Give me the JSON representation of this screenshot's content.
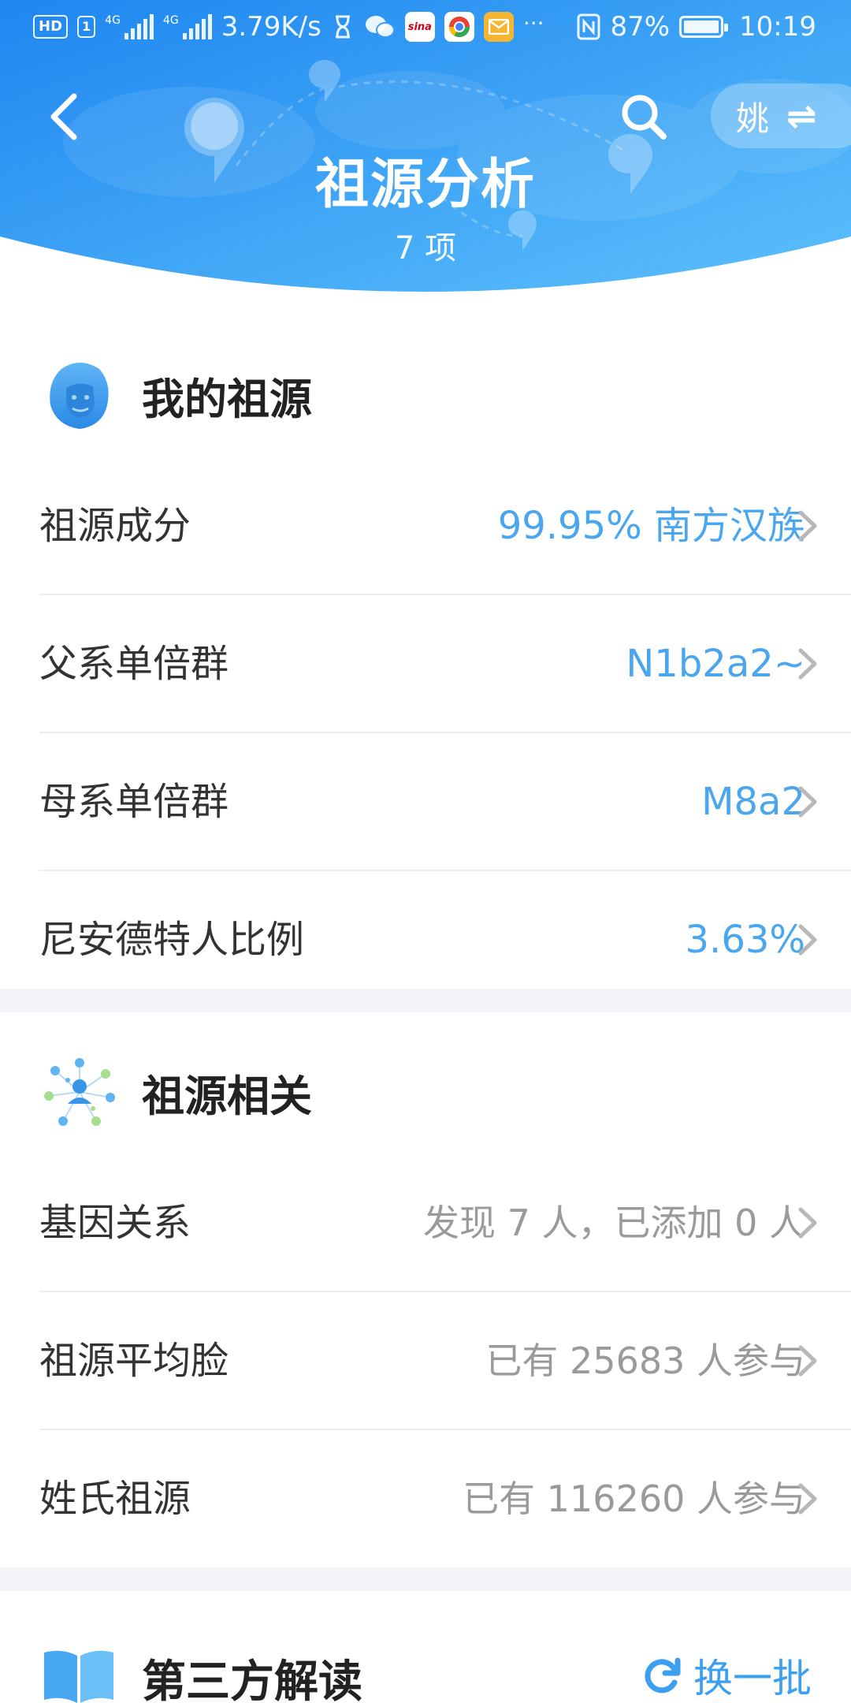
{
  "status_bar": {
    "chip_hd": "HD",
    "chip_sim": "1",
    "net_label_1": "4G",
    "net_label_2": "4G",
    "net_speed": "3.79K/s",
    "app_sina_label": "sina",
    "more": "···",
    "battery_text": "87%",
    "battery_level": 0.87,
    "time": "10:19"
  },
  "header": {
    "title": "祖源分析",
    "subtitle": "7 项",
    "surname": "姚",
    "switch_glyph": "⇌"
  },
  "my_ancestry": {
    "title": "我的祖源",
    "rows": [
      {
        "label": "祖源成分",
        "value": "99.95% 南方汉族"
      },
      {
        "label": "父系单倍群",
        "value": "N1b2a2~"
      },
      {
        "label": "母系单倍群",
        "value": "M8a2"
      },
      {
        "label": "尼安德特人比例",
        "value": "3.63%"
      }
    ]
  },
  "ancestry_related": {
    "title": "祖源相关",
    "rows": [
      {
        "label": "基因关系",
        "value": "发现 7 人，已添加 0 人"
      },
      {
        "label": "祖源平均脸",
        "value": "已有 25683 人参与"
      },
      {
        "label": "姓氏祖源",
        "value": "已有 116260 人参与"
      }
    ]
  },
  "third_party": {
    "title": "第三方解读",
    "refresh_label": "换一批"
  },
  "colors": {
    "header_gradient_start": "#1e86f0",
    "header_gradient_end": "#5cc0fb",
    "accent_value": "#4aa6ee",
    "secondary_value": "#9a9a9a",
    "separator_band": "#f3f5f8"
  },
  "icons": {
    "back": "chevron-left-icon",
    "search": "search-icon",
    "switch": "swap-arrows-icon",
    "my_ancestry": "ancestor-face-icon",
    "ancestry_related": "network-people-icon",
    "third_party": "open-book-icon",
    "refresh": "refresh-icon",
    "row_arrow": "chevron-right-icon"
  }
}
